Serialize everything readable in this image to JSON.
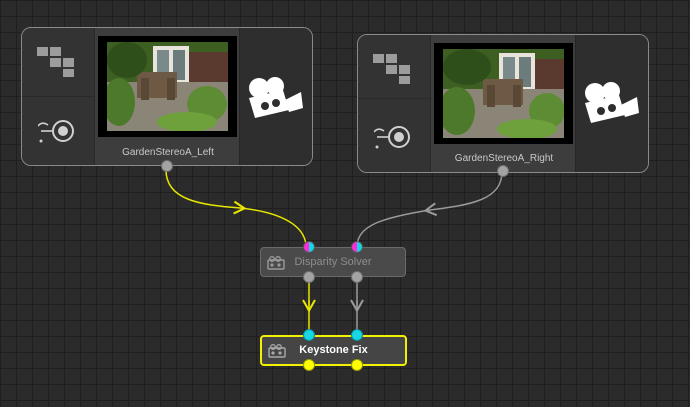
{
  "nodes": {
    "left_read": {
      "label": "GardenStereoA_Left"
    },
    "right_read": {
      "label": "GardenStereoA_Right"
    },
    "disparity": {
      "label": "Disparity Solver"
    },
    "keystone": {
      "label": "Keystone Fix"
    }
  },
  "icons": {
    "grid": "tiles-icon",
    "view": "view-dial-icon",
    "camera": "movie-camera-icon",
    "operator": "film-reel-icon"
  },
  "colors": {
    "selected_wire": "#e6e600",
    "wire": "#9a9a9a",
    "cyan_port": "#17d7e6",
    "magenta_port": "#ff2bd6",
    "yellow_port": "#ffff00"
  }
}
